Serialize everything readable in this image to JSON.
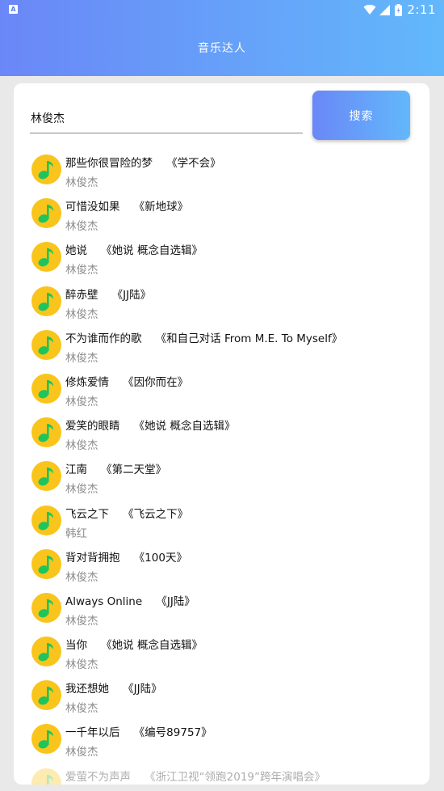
{
  "status_bar": {
    "notification_icon": "A",
    "time": "2:11"
  },
  "header": {
    "title": "音乐达人"
  },
  "search": {
    "value": "林俊杰",
    "button_label": "搜索"
  },
  "songs": [
    {
      "title": "那些你很冒险的梦",
      "album": "《学不会》",
      "artist": "林俊杰"
    },
    {
      "title": "可惜没如果",
      "album": "《新地球》",
      "artist": "林俊杰"
    },
    {
      "title": "她说",
      "album": "《她说 概念自选辑》",
      "artist": "林俊杰"
    },
    {
      "title": "醉赤壁",
      "album": "《JJ陆》",
      "artist": "林俊杰"
    },
    {
      "title": "不为谁而作的歌",
      "album": "《和自己对话 From M.E. To Myself》",
      "artist": "林俊杰"
    },
    {
      "title": "修炼爱情",
      "album": "《因你而在》",
      "artist": "林俊杰"
    },
    {
      "title": "爱笑的眼睛",
      "album": "《她说 概念自选辑》",
      "artist": "林俊杰"
    },
    {
      "title": "江南",
      "album": "《第二天堂》",
      "artist": "林俊杰"
    },
    {
      "title": "飞云之下",
      "album": "《飞云之下》",
      "artist": "韩红"
    },
    {
      "title": "背对背拥抱",
      "album": "《100天》",
      "artist": "林俊杰"
    },
    {
      "title": "Always Online",
      "album": "《JJ陆》",
      "artist": "林俊杰"
    },
    {
      "title": "当你",
      "album": "《她说 概念自选辑》",
      "artist": "林俊杰"
    },
    {
      "title": "我还想她",
      "album": "《JJ陆》",
      "artist": "林俊杰"
    },
    {
      "title": "一千年以后",
      "album": "《编号89757》",
      "artist": "林俊杰"
    },
    {
      "title": "爱萤不为声声",
      "album": "《浙江卫视“领跑2019”跨年演唱会》",
      "artist": ""
    }
  ],
  "colors": {
    "header_gradient_start": "#6a87f7",
    "header_gradient_end": "#62b8fb",
    "icon_yellow": "#f9c51c",
    "icon_green": "#1fc45c"
  },
  "icons": {
    "song": "music-note-icon",
    "wifi": "wifi-icon",
    "signal": "signal-icon",
    "battery": "battery-icon"
  }
}
